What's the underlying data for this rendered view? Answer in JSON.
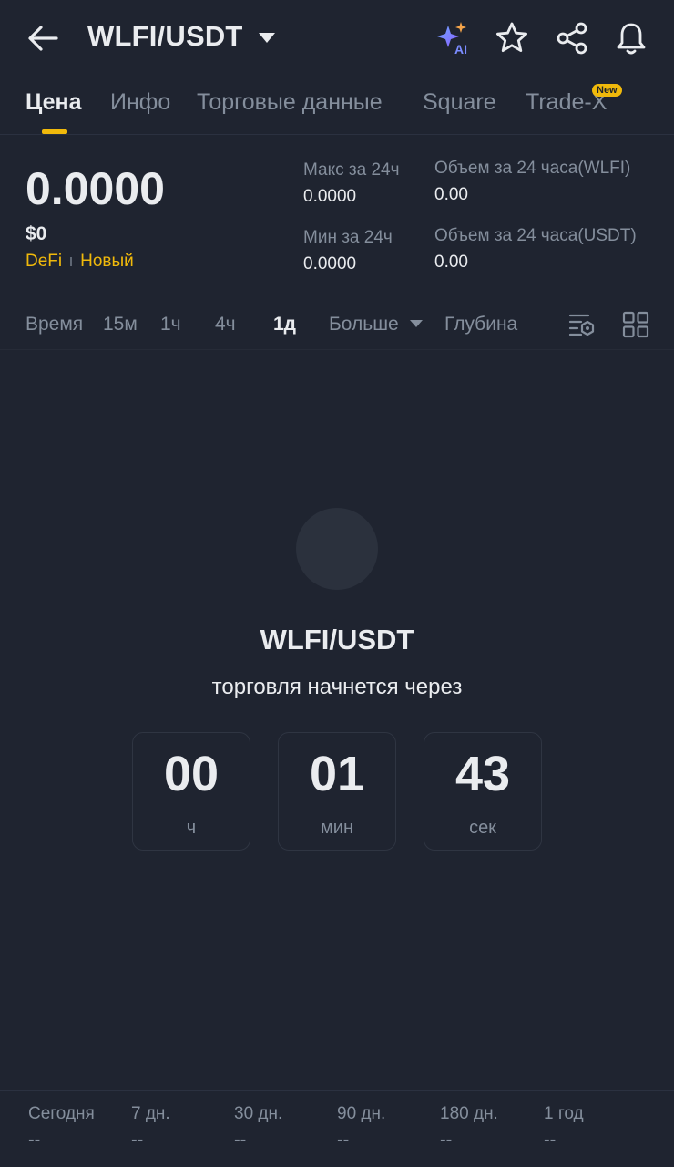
{
  "header": {
    "pair": "WLFI/USDT",
    "icons": [
      "back-arrow-icon",
      "ai-sparkle-icon",
      "star-icon",
      "share-icon",
      "bell-icon"
    ],
    "ai_label": "AI"
  },
  "tabs": [
    {
      "label": "Цена",
      "active": true
    },
    {
      "label": "Инфо",
      "active": false
    },
    {
      "label": "Торговые данные",
      "active": false
    },
    {
      "label": "Square",
      "active": false
    },
    {
      "label": "Trade-X",
      "active": false,
      "badge": "New"
    }
  ],
  "price": {
    "last": "0.0000",
    "usd": "$0",
    "tags": [
      "DeFi",
      "Новый"
    ],
    "stats": {
      "high_label": "Макс за 24ч",
      "high_value": "0.0000",
      "low_label": "Мин за 24ч",
      "low_value": "0.0000",
      "vol_base_label": "Объем за 24 часа(WLFI)",
      "vol_base_value": "0.00",
      "vol_quote_label": "Объем за 24 часа(USDT)",
      "vol_quote_value": "0.00"
    }
  },
  "intervals": {
    "time": "Время",
    "items": [
      "15м",
      "1ч",
      "4ч",
      "1д"
    ],
    "active": "1д",
    "more": "Больше",
    "depth": "Глубина"
  },
  "countdown": {
    "pair": "WLFI/USDT",
    "subtitle": "торговля начнется через",
    "hours": "00",
    "hours_unit": "ч",
    "minutes": "01",
    "minutes_unit": "мин",
    "seconds": "43",
    "seconds_unit": "сек"
  },
  "performance": [
    {
      "label": "Сегодня",
      "value": "--"
    },
    {
      "label": "7 дн.",
      "value": "--"
    },
    {
      "label": "30 дн.",
      "value": "--"
    },
    {
      "label": "90 дн.",
      "value": "--"
    },
    {
      "label": "180 дн.",
      "value": "--"
    },
    {
      "label": "1 год",
      "value": "--"
    }
  ],
  "colors": {
    "background": "#1f2430",
    "accent": "#f0b90b",
    "text_primary": "#eaecef",
    "text_secondary": "#848e9c"
  }
}
